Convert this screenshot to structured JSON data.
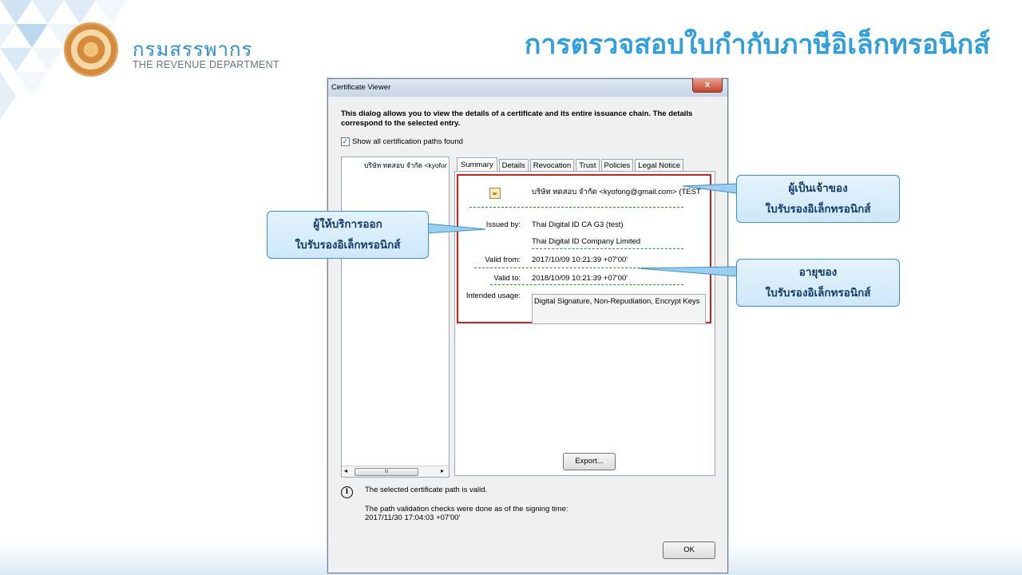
{
  "header": {
    "logo_thai": "กรมสรรพากร",
    "logo_english": "THE REVENUE DEPARTMENT",
    "page_title": "การตรวจสอบใบกำกับภาษีอิเล็กทรอนิกส์"
  },
  "dialog": {
    "title": "Certificate Viewer",
    "close_label": "x",
    "description": "This dialog allows you to view the details of a certificate and its entire issuance chain. The details correspond to the selected entry.",
    "show_all_label": "Show all certification paths found",
    "show_all_checked": true,
    "tree_item": "บริษัท ทดสอบ จำกัด <kyofong@gmail.com>",
    "scroll_thumb": "III",
    "tabs": [
      {
        "label": "Summary",
        "active": true
      },
      {
        "label": "Details",
        "active": false
      },
      {
        "label": "Revocation",
        "active": false
      },
      {
        "label": "Trust",
        "active": false
      },
      {
        "label": "Policies",
        "active": false
      },
      {
        "label": "Legal Notice",
        "active": false
      }
    ],
    "summary": {
      "subject": "บริษัท ทดสอบ จำกัด <kyofong@gmail.com> (TEST",
      "issued_by_label": "Issued by:",
      "issued_by_line1": "Thai Digital ID CA G3 (test)",
      "issued_by_line2": "Thai Digital ID Company Limited",
      "valid_from_label": "Valid from:",
      "valid_from": "2017/10/09 10:21:39 +07'00'",
      "valid_to_label": "Valid to:",
      "valid_to": "2018/10/09 10:21:39 +07'00'",
      "usage_label": "Intended usage:",
      "usage": "Digital Signature, Non-Repudiation, Encrypt Keys"
    },
    "export_label": "Export...",
    "valid_path_text": "The selected certificate path is valid.",
    "check_line1": "The path validation checks were done as of the signing time:",
    "check_line2": "2017/11/30 17:04:03 +07'00'",
    "ok_label": "OK"
  },
  "callouts": {
    "owner_line1": "ผู้เป็นเจ้าของ",
    "owner_line2": "ใบรับรองอิเล็กทรอนิกส์",
    "issuer_line1": "ผู้ให้บริการออก",
    "issuer_line2": "ใบรับรองอิเล็กทรอนิกส์",
    "validity_line1": "อายุของ",
    "validity_line2": "ใบรับรองอิเล็กทรอนิกส์"
  },
  "colors": {
    "title_blue": "#2f9fe0",
    "highlight_red": "#d11f1f",
    "dash_green": "#1f9a2a",
    "callout_border": "#3b8fd1"
  }
}
